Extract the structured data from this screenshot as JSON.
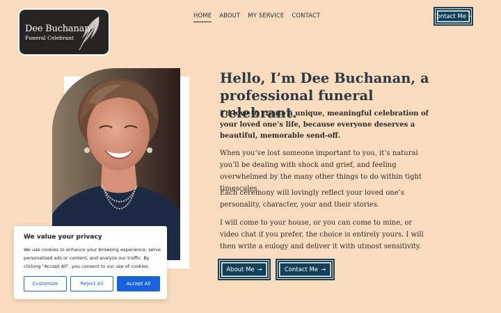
{
  "logo": {
    "name": "Dee Buchanan",
    "subtitle": "Funeral Celebrant",
    "icon": "feather-icon"
  },
  "nav": {
    "items": [
      {
        "label": "HOME",
        "active": true
      },
      {
        "label": "ABOUT",
        "active": false
      },
      {
        "label": "MY SERVICE",
        "active": false
      },
      {
        "label": "CONTACT",
        "active": false
      }
    ],
    "contact_button": "Contact Me",
    "arrow": "→"
  },
  "hero": {
    "headline": "Hello, I’m Dee Buchanan, a professional funeral celebrant.",
    "lead": "I’d love to create a unique, meaningful celebration of your loved one’s life, because everyone deserves a beautiful, memorable send-off.",
    "paragraphs": [
      "When you’ve lost someone important to you, it’s natural you’ll be dealing with shock and grief, and feeling overwhelmed by the many other things to do within tight timescales.",
      "Each ceremony will lovingly reflect your loved one’s personality, character, your and their stories.",
      "I will come to your house, or you can come to mine, or video chat if you prefer, the choice is entirely yours. I will then write a eulogy and deliver it with utmost sensitivity."
    ],
    "about_button": "About Me",
    "contact_button": "Contact Me"
  },
  "cookie": {
    "title": "We value your privacy",
    "text": "We use cookies to enhance your browsing experience, serve personalized ads or content, and analyze our traffic. By clicking \"Accept All\", you consent to our use of cookies.",
    "customize": "Customize",
    "reject": "Reject All",
    "accept": "Accept All"
  },
  "colors": {
    "background": "#f9dcbd",
    "primary": "#12405b",
    "cookie_accent": "#1863dc"
  }
}
